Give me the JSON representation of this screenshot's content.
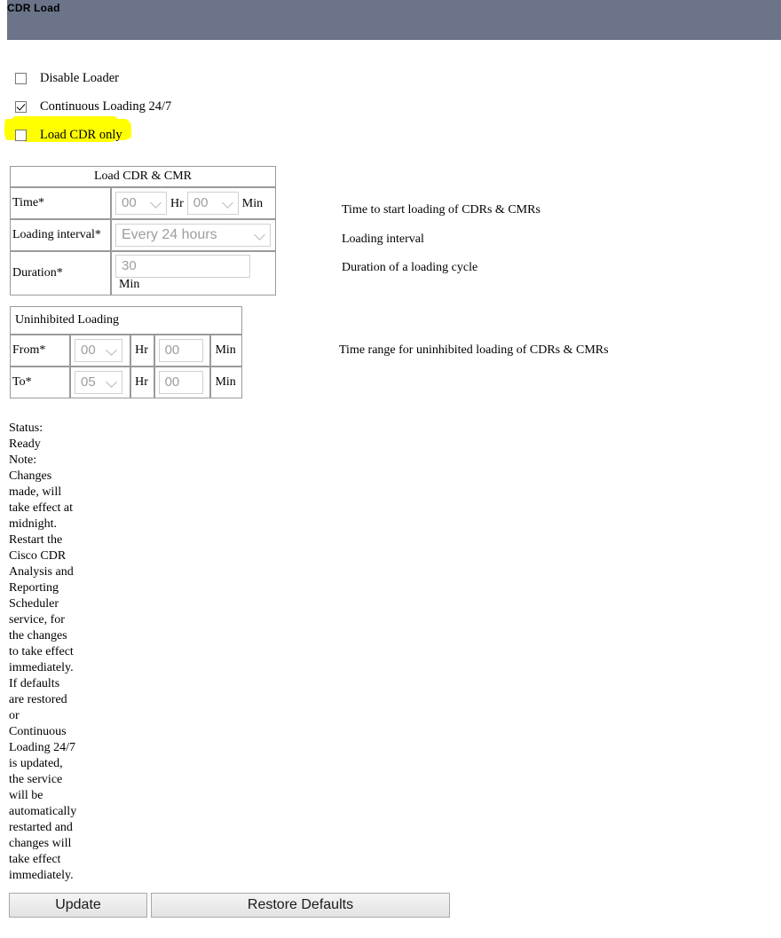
{
  "header": {
    "title": "CDR Load",
    "bar_color": "#6b7488"
  },
  "checkboxes": [
    {
      "label": "Disable Loader",
      "checked": false,
      "highlighted": false
    },
    {
      "label": "Continuous Loading 24/7",
      "checked": true,
      "highlighted": false
    },
    {
      "label": "Load CDR only",
      "checked": false,
      "highlighted": true
    }
  ],
  "highlight_color": "#ffff00",
  "load_table": {
    "title": "Load CDR & CMR",
    "rows": [
      {
        "label": "Time*",
        "hour_value": "00",
        "hour_unit": "Hr",
        "minute_value": "00",
        "minute_unit": "Min"
      },
      {
        "label": "Loading interval*",
        "interval_value": "Every 24 hours"
      },
      {
        "label": "Duration*",
        "duration_value": "30",
        "duration_unit": "Min"
      }
    ]
  },
  "uninhibited_table": {
    "title": "Uninhibited Loading",
    "rows": [
      {
        "label": "From*",
        "hour_value": "00",
        "hour_unit": "Hr",
        "minute_value": "00",
        "minute_unit": "Min"
      },
      {
        "label": "To*",
        "hour_value": "05",
        "hour_unit": "Hr",
        "minute_value": "00",
        "minute_unit": "Min"
      }
    ]
  },
  "descriptions": {
    "time": "Time to start loading of CDRs & CMRs",
    "interval": "Loading interval",
    "duration": "Duration of a loading cycle",
    "uninhibited": "Time range for uninhibited loading of CDRs & CMRs"
  },
  "status": {
    "lines": [
      "Status:",
      "Ready",
      "Note:",
      "Changes",
      "made, will",
      "take effect at",
      "midnight.",
      "Restart the",
      "Cisco CDR",
      "Analysis and",
      "Reporting",
      "Scheduler",
      "service, for",
      "the changes",
      "to take effect",
      "immediately.",
      "If defaults",
      "are restored",
      "or",
      "Continuous",
      "Loading 24/7",
      "is updated,",
      "the service",
      "will be",
      "automatically",
      "restarted and",
      "changes will",
      "take effect",
      "immediately."
    ]
  },
  "buttons": {
    "update": "Update",
    "restore": "Restore Defaults"
  }
}
